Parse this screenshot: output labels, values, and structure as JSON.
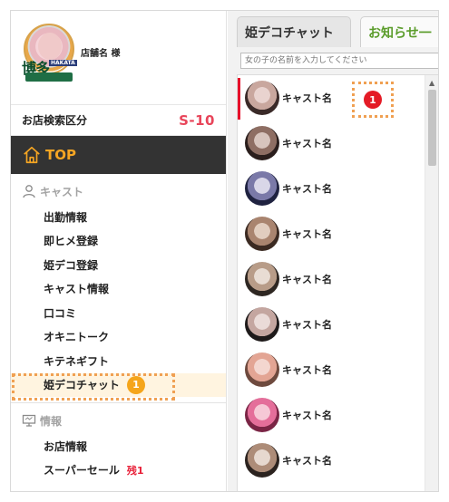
{
  "shop": {
    "name": "店舗名 様",
    "logo_text": "博多",
    "logo_badge": "HAKATA"
  },
  "search_category": {
    "label": "お店検索区分",
    "code": "S-10"
  },
  "nav": {
    "top_label": "TOP"
  },
  "cast_section": {
    "heading": "キャスト",
    "items": [
      "出勤情報",
      "即ヒメ登録",
      "姫デコ登録",
      "キャスト情報",
      "口コミ",
      "オキニトーク",
      "キテネギフト",
      "姫デコチャット"
    ],
    "active_badge": "1"
  },
  "info_section": {
    "heading": "情報",
    "items": [
      "お店情報",
      "スーパーセール"
    ],
    "sale_stock": "残1"
  },
  "tabs": {
    "active": "姫デコチャット",
    "inactive": "お知らせ一"
  },
  "cast_search": {
    "placeholder": "女の子の名前を入力してください"
  },
  "cast_list": [
    {
      "name": "キャスト名",
      "unread": "1"
    },
    {
      "name": "キャスト名"
    },
    {
      "name": "キャスト名"
    },
    {
      "name": "キャスト名"
    },
    {
      "name": "キャスト名"
    },
    {
      "name": "キャスト名"
    },
    {
      "name": "キャスト名"
    },
    {
      "name": "キャスト名"
    },
    {
      "name": "キャスト名"
    }
  ],
  "colors": {
    "sidebar_nav_bg": "#333333",
    "accent_orange": "#f6a623",
    "code_red": "#e8455a",
    "badge_red": "#e41b26",
    "badge_orange": "#f5a51b",
    "info_tab_green": "#5a9c2a"
  }
}
